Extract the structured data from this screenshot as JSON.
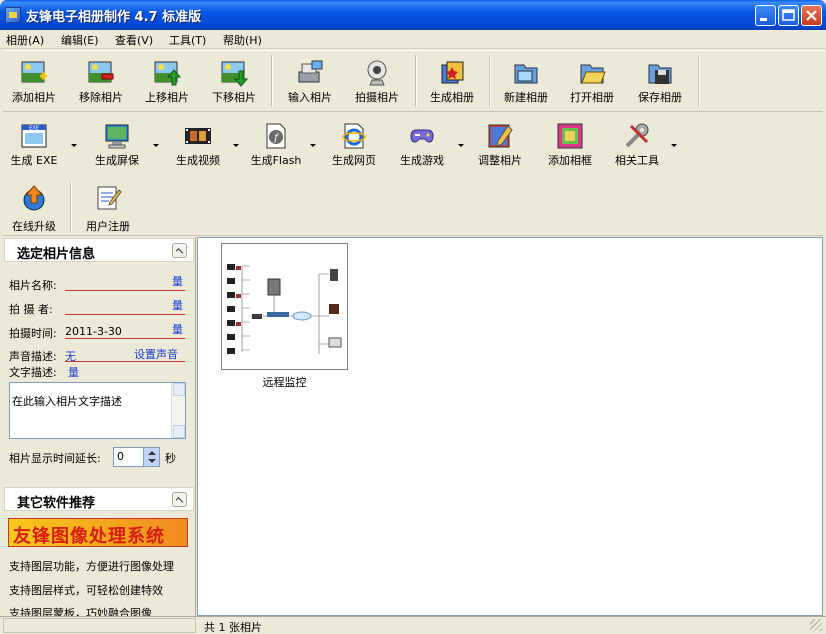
{
  "window": {
    "title": "友锋电子相册制作 4.7 标准版"
  },
  "menu": [
    "相册(A)",
    "编辑(E)",
    "查看(V)",
    "工具(T)",
    "帮助(H)"
  ],
  "toolbar1": {
    "add": "添加相片",
    "remove": "移除相片",
    "move_up": "上移相片",
    "move_down": "下移相片",
    "import": "输入相片",
    "capture": "拍摄相片",
    "generate": "生成相册",
    "new": "新建相册",
    "open": "打开相册",
    "save": "保存相册"
  },
  "toolbar2": {
    "exe": "生成 EXE",
    "screensaver": "生成屏保",
    "video": "生成视频",
    "flash": "生成Flash",
    "webpage": "生成网页",
    "game": "生成游戏",
    "adjust": "调整相片",
    "frame": "添加相框",
    "tools": "相关工具",
    "exe_icon_text": "EXE"
  },
  "toolbar3": {
    "upgrade": "在线升级",
    "register": "用户注册"
  },
  "info_panel": {
    "title": "选定相片信息",
    "name_label": "相片名称:",
    "name_value": "",
    "photographer_label": "拍 摄 者:",
    "photographer_value": "",
    "time_label": "拍摄时间:",
    "time_value": "2011-3-30",
    "sound_label": "声音描述:",
    "sound_value": "无",
    "sound_link": "设置声音",
    "text_label": "文字描述:",
    "edit_glyph": "量",
    "desc_placeholder": "在此输入相片文字描述",
    "delay_label": "相片显示时间延长:",
    "delay_value": "0",
    "delay_unit": "秒"
  },
  "recommend_panel": {
    "title": "其它软件推荐",
    "banner": "友锋图像处理系统",
    "lines": [
      "支持图层功能，方便进行图像处理",
      "支持图层样式，可轻松创建特效",
      "支持图层蒙板，巧妙融合图像"
    ]
  },
  "gallery": {
    "items": [
      {
        "caption": "远程监控"
      }
    ]
  },
  "status": {
    "text": "共 1 张相片"
  },
  "colors": {
    "title_bar": "#0656e4",
    "underline": "#c0392b",
    "link": "#1a3ccc",
    "banner_text": "#d81e10"
  }
}
